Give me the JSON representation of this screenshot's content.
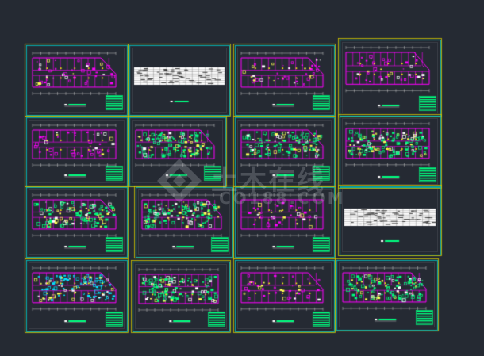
{
  "drawing_sheets": [
    {
      "row": 1,
      "col": 1,
      "kind": "floor-plan",
      "accent": "#ff00ff"
    },
    {
      "row": 1,
      "col": 2,
      "kind": "table"
    },
    {
      "row": 1,
      "col": 3,
      "kind": "floor-plan",
      "accent": "#ff00ff"
    },
    {
      "row": 1,
      "col": 4,
      "kind": "floor-plan",
      "accent": "#ff00ff"
    },
    {
      "row": 2,
      "col": 1,
      "kind": "floor-plan",
      "accent": "#ff00ff"
    },
    {
      "row": 2,
      "col": 2,
      "kind": "floor-plan",
      "accent": "#00ff7f"
    },
    {
      "row": 2,
      "col": 3,
      "kind": "floor-plan",
      "accent": "#00ff7f"
    },
    {
      "row": 2,
      "col": 4,
      "kind": "floor-plan",
      "accent": "#00ff7f"
    },
    {
      "row": 3,
      "col": 1,
      "kind": "floor-plan",
      "accent": "#00ff7f"
    },
    {
      "row": 3,
      "col": 2,
      "kind": "floor-plan",
      "accent": "#00ff7f"
    },
    {
      "row": 3,
      "col": 3,
      "kind": "floor-plan",
      "accent": "#ff00ff"
    },
    {
      "row": 3,
      "col": 4,
      "kind": "table"
    },
    {
      "row": 4,
      "col": 1,
      "kind": "floor-plan",
      "accent": "#00e5ff"
    },
    {
      "row": 4,
      "col": 2,
      "kind": "floor-plan",
      "accent": "#00ff7f"
    },
    {
      "row": 4,
      "col": 3,
      "kind": "floor-plan",
      "accent": "#ff00ff"
    },
    {
      "row": 4,
      "col": 4,
      "kind": "floor-plan",
      "accent": "#00ff7f"
    }
  ],
  "colors": {
    "background": "#252a33",
    "frame": "#d8d8d8",
    "outer_frame": "#d4c700",
    "inner_frame": "#00c9c9",
    "walls": "#ff00ff",
    "fixtures": "#00ff7f",
    "dimension": "#c8c8c8",
    "title_block": "#00ff7f",
    "table_bg": "#ffffff"
  },
  "watermark": {
    "brand": "土木在线",
    "url": "CO188.COM"
  }
}
